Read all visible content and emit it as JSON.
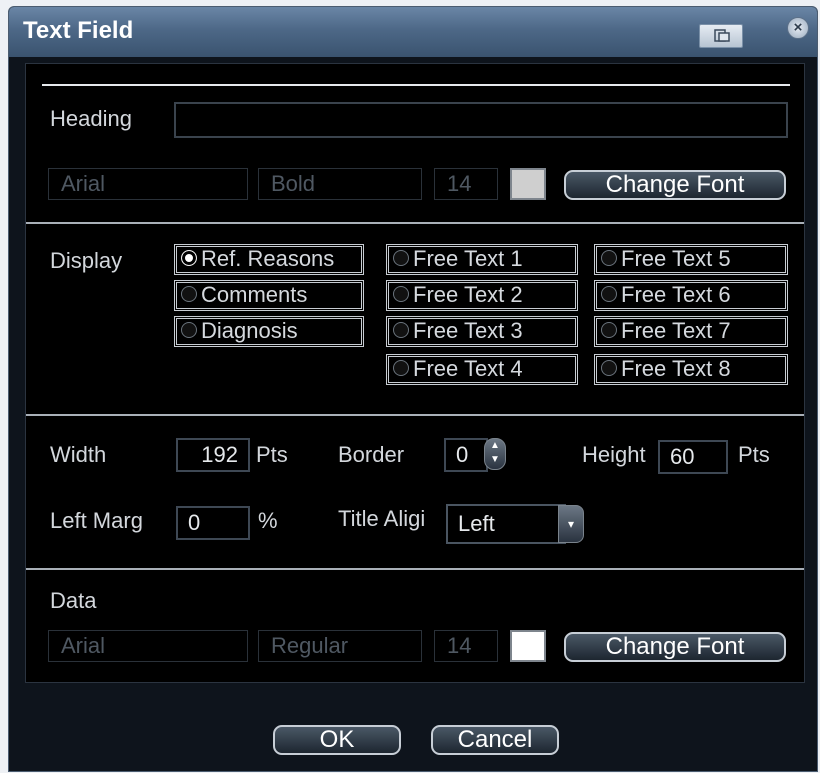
{
  "window": {
    "title": "Text Field"
  },
  "heading": {
    "label": "Heading",
    "value": "",
    "font": "Arial",
    "style": "Bold",
    "size": "14",
    "color": "#cfcfcf",
    "change_font": "Change Font"
  },
  "display": {
    "label": "Display",
    "options": [
      {
        "label": "Ref. Reasons",
        "selected": true
      },
      {
        "label": "Comments",
        "selected": false
      },
      {
        "label": "Diagnosis",
        "selected": false
      },
      {
        "label": "Free Text 1",
        "selected": false
      },
      {
        "label": "Free Text 2",
        "selected": false
      },
      {
        "label": "Free Text 3",
        "selected": false
      },
      {
        "label": "Free Text 4",
        "selected": false
      },
      {
        "label": "Free Text 5",
        "selected": false
      },
      {
        "label": "Free Text 6",
        "selected": false
      },
      {
        "label": "Free Text 7",
        "selected": false
      },
      {
        "label": "Free Text 8",
        "selected": false
      }
    ]
  },
  "layout": {
    "width_label": "Width",
    "width_value": "192",
    "width_unit": "Pts",
    "border_label": "Border",
    "border_value": "0",
    "height_label": "Height",
    "height_value": "60",
    "height_unit": "Pts",
    "left_margin_label": "Left Marg",
    "left_margin_value": "0",
    "left_margin_unit": "%",
    "title_align_label": "Title Aligi",
    "title_align_value": "Left"
  },
  "data": {
    "label": "Data",
    "font": "Arial",
    "style": "Regular",
    "size": "14",
    "color": "#ffffff",
    "change_font": "Change Font"
  },
  "buttons": {
    "ok": "OK",
    "cancel": "Cancel"
  },
  "icons": {
    "restore": "restore-icon",
    "close": "close-icon",
    "spin": "spinner-icon",
    "dropdown": "chevron-down-icon"
  }
}
